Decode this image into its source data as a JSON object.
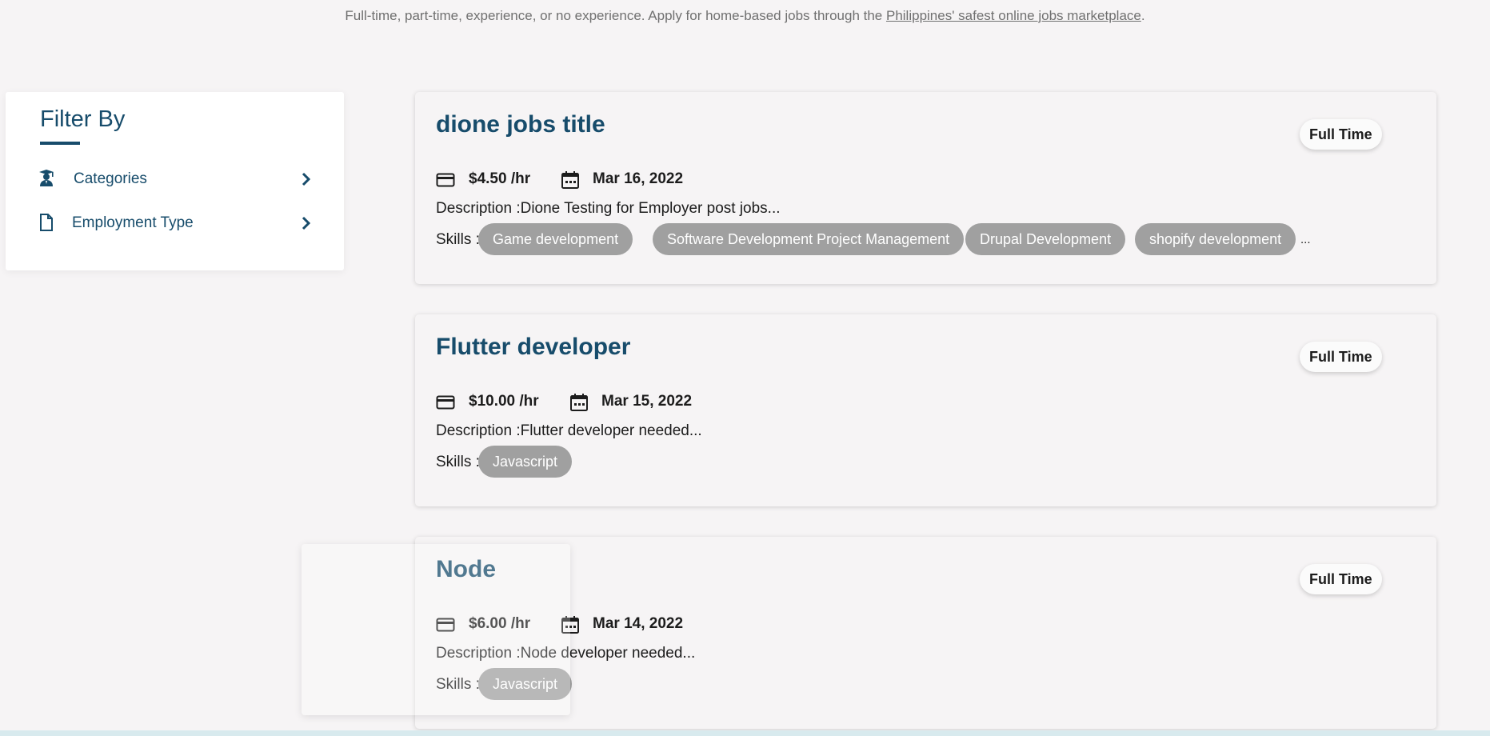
{
  "header": {
    "tagline_text": "Full-time, part-time, experience, or no experience. Apply for home-based jobs through the ",
    "tagline_link": "Philippines' safest online jobs marketplace",
    "tagline_end": "."
  },
  "filter": {
    "title": "Filter By",
    "items": [
      {
        "label": "Categories",
        "icon": "graduate-icon"
      },
      {
        "label": "Employment Type",
        "icon": "document-icon"
      }
    ]
  },
  "jobs": [
    {
      "title": "dione jobs title",
      "badge": "Full Time",
      "rate": "$4.50 /hr",
      "date": "Mar 16, 2022",
      "description": "Description :Dione Testing for Employer post jobs...",
      "skills_label": "Skills :",
      "skills": [
        "Game development",
        "Software Development Project Management",
        "Drupal Development",
        "shopify development"
      ],
      "more": "..."
    },
    {
      "title": "Flutter developer",
      "badge": "Full Time",
      "rate": "$10.00 /hr",
      "date": "Mar 15, 2022",
      "description": "Description :Flutter developer needed...",
      "skills_label": "Skills :",
      "skills": [
        "Javascript"
      ]
    },
    {
      "title": "Node",
      "badge": "Full Time",
      "rate": "$6.00 /hr",
      "date": "Mar 14, 2022",
      "description": "Description :Node developer needed...",
      "skills_label": "Skills :",
      "skills": [
        "Javascript"
      ]
    }
  ],
  "colors": {
    "accent": "#174c6b",
    "chip": "#a0a0a0",
    "background": "#f6f4f5"
  }
}
